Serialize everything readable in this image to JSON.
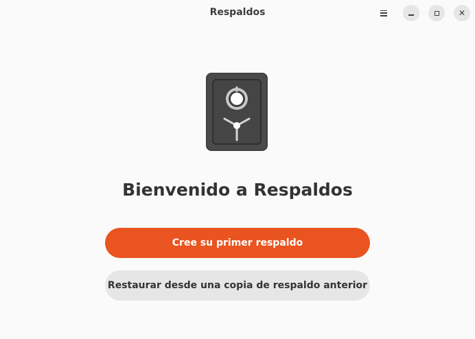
{
  "window": {
    "title": "Respaldos"
  },
  "headerbar": {
    "menu_icon": "hamburger-menu-icon",
    "minimize_icon": "minimize-icon",
    "maximize_icon": "maximize-icon",
    "close_icon": "close-icon",
    "close_glyph": "✕"
  },
  "main": {
    "app_icon": "vault-safe-icon",
    "welcome_title": "Bienvenido a Respaldos",
    "primary_button_label": "Cree su primer respaldo",
    "secondary_button_label": "Restaurar desde una copia de respaldo anterior"
  },
  "colors": {
    "accent": "#e95420",
    "background": "#fafafa",
    "secondary_button": "#e6e6e6",
    "text": "#333333"
  }
}
